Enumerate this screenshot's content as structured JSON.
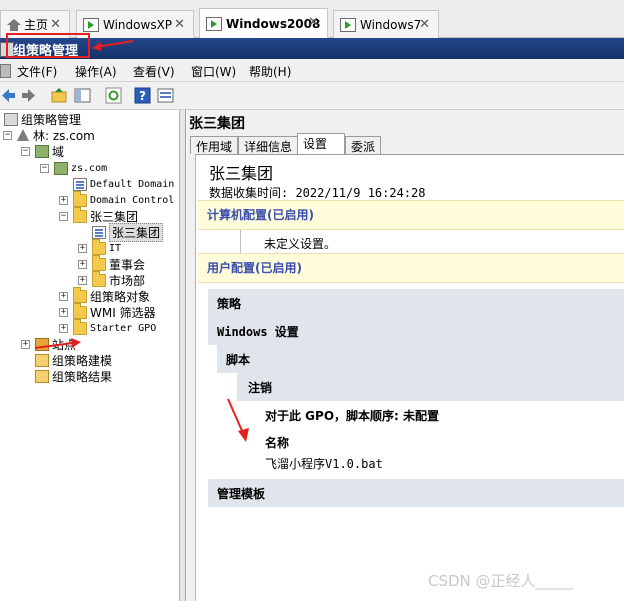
{
  "browser_tabs": [
    {
      "label": "主页"
    },
    {
      "label": "WindowsXP"
    },
    {
      "label": "Windows2008"
    },
    {
      "label": "Windows7"
    }
  ],
  "window_title": "组策略管理",
  "menu": [
    "文件(F)",
    "操作(A)",
    "查看(V)",
    "窗口(W)",
    "帮助(H)"
  ],
  "tree": {
    "root": "组策略管理",
    "forest": "林: zs.com",
    "domains": "域",
    "domain": "zs.com",
    "default_policy": "Default Domain",
    "domain_controllers": "Domain Control",
    "ou": "张三集团",
    "ou_gpo": "张三集团",
    "sub_ous": [
      "IT",
      "董事会",
      "市场部"
    ],
    "gpo_objects": "组策略对象",
    "wmi": "WMI 筛选器",
    "starter": "Starter GPO",
    "sites": "站点",
    "modeling": "组策略建模",
    "results": "组策略结果"
  },
  "right": {
    "title": "张三集团",
    "tabs": [
      "作用域",
      "详细信息",
      "设置",
      "委派"
    ],
    "active_tab": "设置",
    "gpo_name": "张三集团",
    "collected_time": "数据收集时间: 2022/11/9 16:24:28",
    "computer_config": "计算机配置(已启用)",
    "undefined_settings": "未定义设置。",
    "user_config": "用户配置(已启用)",
    "policies": "策略",
    "windows_settings": "Windows 设置",
    "scripts": "脚本",
    "logoff": "注销",
    "script_order": "对于此 GPO，脚本顺序: 未配置",
    "name_header": "名称",
    "script_name": "飞溜小程序V1.0.bat",
    "admin_templates": "管理模板"
  },
  "watermark": "CSDN @正经人_____",
  "colors": {
    "title_bar": "#1c3a7a",
    "section_title": "#3c4eb0",
    "annotation": "#e32020",
    "band": "#dfe5ea",
    "section_bg": "#fefcd9"
  }
}
